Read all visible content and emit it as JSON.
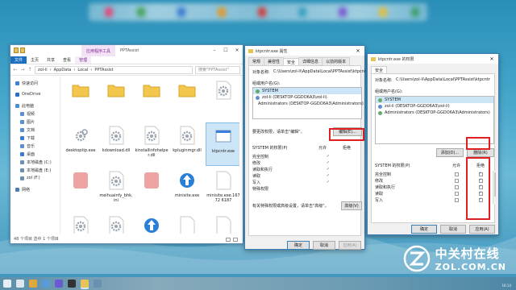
{
  "explorer": {
    "context_tab": "应用程序工具",
    "window_name": "PPTAssist",
    "ribbon_tabs": [
      "文件",
      "主页",
      "共享",
      "查看",
      "管理"
    ],
    "breadcrumb": [
      "zol-li",
      "AppData",
      "Local",
      "PPTAssist"
    ],
    "search_placeholder": "搜索\"PPTAssist\"",
    "nav": [
      {
        "label": "快速访问",
        "sub": false,
        "color": "#3b7fd9"
      },
      {
        "label": "OneDrive",
        "sub": false,
        "color": "#2b6fc9"
      },
      {
        "label": "此电脑",
        "sub": false,
        "color": "#4a90d0"
      },
      {
        "label": "视频",
        "sub": true,
        "color": "#5a8fd0"
      },
      {
        "label": "图片",
        "sub": true,
        "color": "#5a8fd0"
      },
      {
        "label": "文档",
        "sub": true,
        "color": "#5a8fd0"
      },
      {
        "label": "下载",
        "sub": true,
        "color": "#3a7ad0"
      },
      {
        "label": "音乐",
        "sub": true,
        "color": "#5a8fd0"
      },
      {
        "label": "桌面",
        "sub": true,
        "color": "#3a7ad0"
      },
      {
        "label": "本地磁盘 (C:)",
        "sub": true,
        "color": "#6a8fb0"
      },
      {
        "label": "本地磁盘 (E:)",
        "sub": true,
        "color": "#6a8fb0"
      },
      {
        "label": "zol (F:)",
        "sub": true,
        "color": "#6a8fb0"
      },
      {
        "label": "网络",
        "sub": false,
        "color": "#4a7fb0"
      }
    ],
    "files": [
      {
        "name": "",
        "icon": "folder"
      },
      {
        "name": "",
        "icon": "folder"
      },
      {
        "name": "",
        "icon": "folder"
      },
      {
        "name": "",
        "icon": "folder"
      },
      {
        "name": "",
        "icon": "config"
      },
      {
        "name": "",
        "icon": "blank"
      },
      {
        "name": "desktoptip.exe",
        "icon": "exe-gear"
      },
      {
        "name": "kdownload.dll",
        "icon": "dll-gear"
      },
      {
        "name": "kinstallinfohelper.dll",
        "icon": "dll-gear"
      },
      {
        "name": "kpluginmgr.dll",
        "icon": "dll-gear"
      },
      {
        "name": "ktpcntr.exe",
        "icon": "exe-window",
        "selected": true
      },
      {
        "name": "",
        "icon": "none"
      },
      {
        "name": "",
        "icon": "blurred-red"
      },
      {
        "name": "meihuainfy_bhk.ini",
        "icon": "ini-gear"
      },
      {
        "name": "",
        "icon": "blurred-red"
      },
      {
        "name": "minisite.exe",
        "icon": "exe-blue-arrow"
      },
      {
        "name": "minisite.exe.16772 6187",
        "icon": "exe-blank"
      },
      {
        "name": "",
        "icon": "none"
      },
      {
        "name": "msvcp100.dll",
        "icon": "dll-gear"
      },
      {
        "name": "msvcr100.dll",
        "icon": "dll-gear"
      },
      {
        "name": "notify.exe",
        "icon": "exe-blue-arrow"
      },
      {
        "name": "notify.exe.16772 3671",
        "icon": "exe-blank"
      },
      {
        "name": "notify.exe.16772 6078",
        "icon": "exe-blank"
      },
      {
        "name": "",
        "icon": "none"
      },
      {
        "name": "",
        "icon": "dll-gear"
      },
      {
        "name": "",
        "icon": "ppt-red"
      },
      {
        "name": "",
        "icon": "dll-gear"
      },
      {
        "name": "",
        "icon": "dll-gear"
      },
      {
        "name": "",
        "icon": "dll-gear"
      },
      {
        "name": "",
        "icon": "none"
      }
    ],
    "status": "48 个项目   选中 1 个项目"
  },
  "props": {
    "title": "ktpcntr.exe 属性",
    "tabs": [
      "常规",
      "兼容性",
      "安全",
      "详细信息",
      "以前的版本"
    ],
    "active_tab": "安全",
    "object_label": "对象名称:",
    "object_value": "C:\\Users\\zol-li\\AppData\\Local\\PPTAssist\\ktpcntr.exe",
    "group_label": "组或用户名(G):",
    "users": [
      "SYSTEM",
      "zol-li (DESKTOP-GGDO6A3\\zol-li)",
      "Administrators (DESKTOP-GGDO6A3\\Administrators)"
    ],
    "change_hint": "要更改权限，请单击\"编辑\"。",
    "edit_button": "编辑(E)...",
    "perm_header": "SYSTEM 的权限(P)",
    "allow": "允许",
    "deny": "拒绝",
    "perms": [
      "完全控制",
      "修改",
      "读取和执行",
      "读取",
      "写入",
      "特殊权限"
    ],
    "allow_marks": [
      true,
      true,
      true,
      true,
      true,
      false
    ],
    "special_hint": "有关特殊权限或高级设置，请单击\"高级\"。",
    "advanced_button": "高级(V)",
    "ok": "确定",
    "cancel": "取消",
    "apply": "应用(A)"
  },
  "perm": {
    "title": "ktpcntr.exe 的权限",
    "tab": "安全",
    "object_label": "对象名称:",
    "object_value": "C:\\Users\\zol-li\\AppData\\Local\\PPTAssist\\ktpcntr",
    "group_label": "组或用户名(G):",
    "users": [
      "SYSTEM",
      "zol-li (DESKTOP-GGDO6A3\\zol-li)",
      "Administrators (DESKTOP-GGDO6A3\\Administrators)"
    ],
    "add_button": "添加(D)...",
    "remove_button": "删除(R)",
    "perm_header": "SYSTEM 的权限(P)",
    "allow": "允许",
    "deny": "拒绝",
    "perms": [
      "完全控制",
      "修改",
      "读取和执行",
      "读取",
      "写入"
    ],
    "deny_checked": [
      true,
      true,
      true,
      true,
      true
    ],
    "ok": "确定",
    "cancel": "取消",
    "apply": "应用(A)"
  },
  "watermark": {
    "cn": "中关村在线",
    "en": "ZOL.COM.CN"
  },
  "date": "16:14"
}
